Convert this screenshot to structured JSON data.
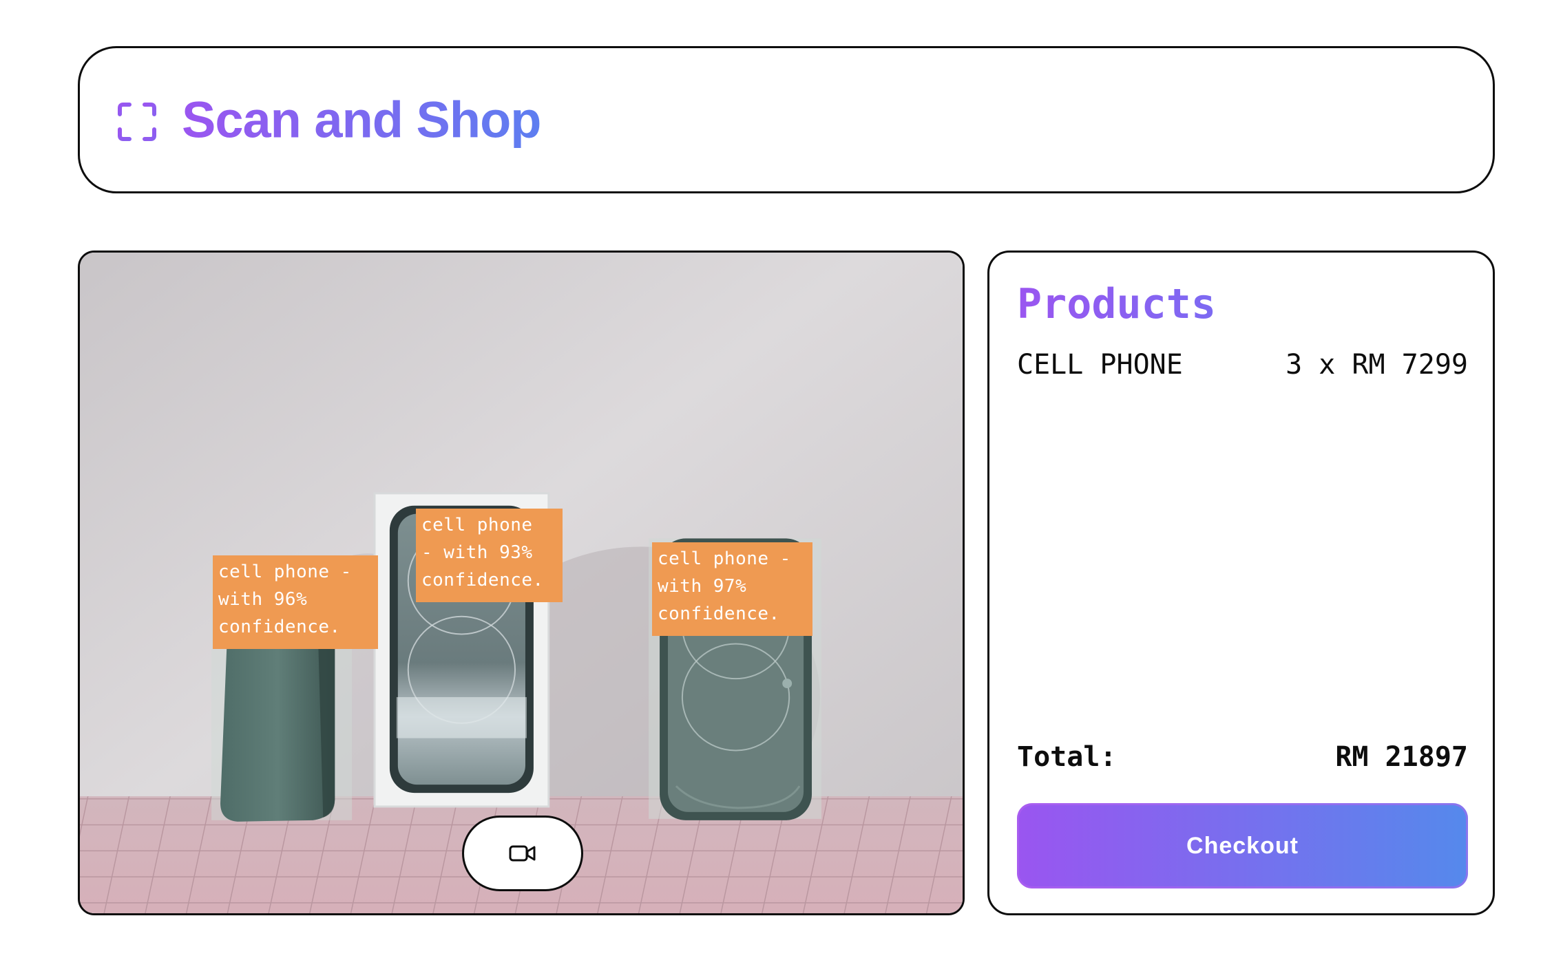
{
  "header": {
    "title": "Scan and Shop",
    "icon": "scan-frame-icon"
  },
  "camera": {
    "detections": [
      {
        "label": "cell phone -\nwith 96%\nconfidence.",
        "class": "cell phone",
        "confidence": 96
      },
      {
        "label": "cell phone\n- with 93%\nconfidence.",
        "class": "cell phone",
        "confidence": 93
      },
      {
        "label": "cell phone -\nwith 97%\nconfidence.",
        "class": "cell phone",
        "confidence": 97
      }
    ],
    "record_button_icon": "video-camera-icon"
  },
  "products": {
    "title": "Products",
    "items": [
      {
        "name": "CELL PHONE",
        "quantity_price": "3 x RM 7299"
      }
    ],
    "total_label": "Total:",
    "total_value": "RM 21897",
    "checkout_label": "Checkout"
  },
  "colors": {
    "accent_purple": "#9a55f0",
    "accent_blue": "#5589ec",
    "detection_label": "#ef9a52",
    "border": "#0d0d0d"
  }
}
